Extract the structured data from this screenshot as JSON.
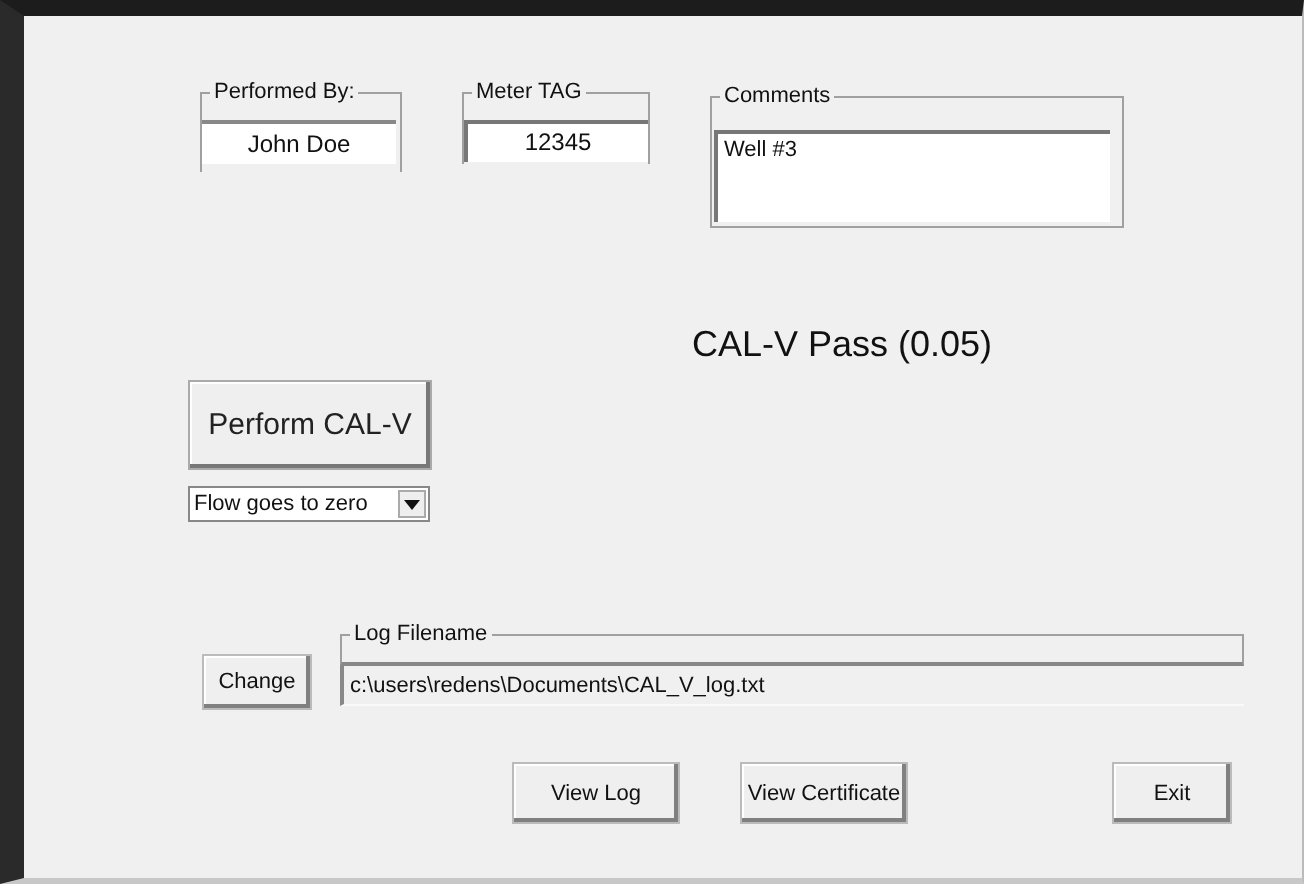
{
  "performed_by": {
    "label": "Performed By:",
    "value": "John Doe"
  },
  "meter_tag": {
    "label": "Meter TAG",
    "value": "12345"
  },
  "comments": {
    "label": "Comments",
    "value": "Well #3"
  },
  "status": "CAL-V Pass (0.05)",
  "perform_button": "Perform CAL-V",
  "mode_dropdown": {
    "value": "Flow goes to zero"
  },
  "change_button": "Change",
  "log_filename": {
    "label": "Log Filename",
    "value": "c:\\users\\redens\\Documents\\CAL_V_log.txt"
  },
  "buttons": [
    "View Log",
    "View Certificate",
    "Exit"
  ]
}
